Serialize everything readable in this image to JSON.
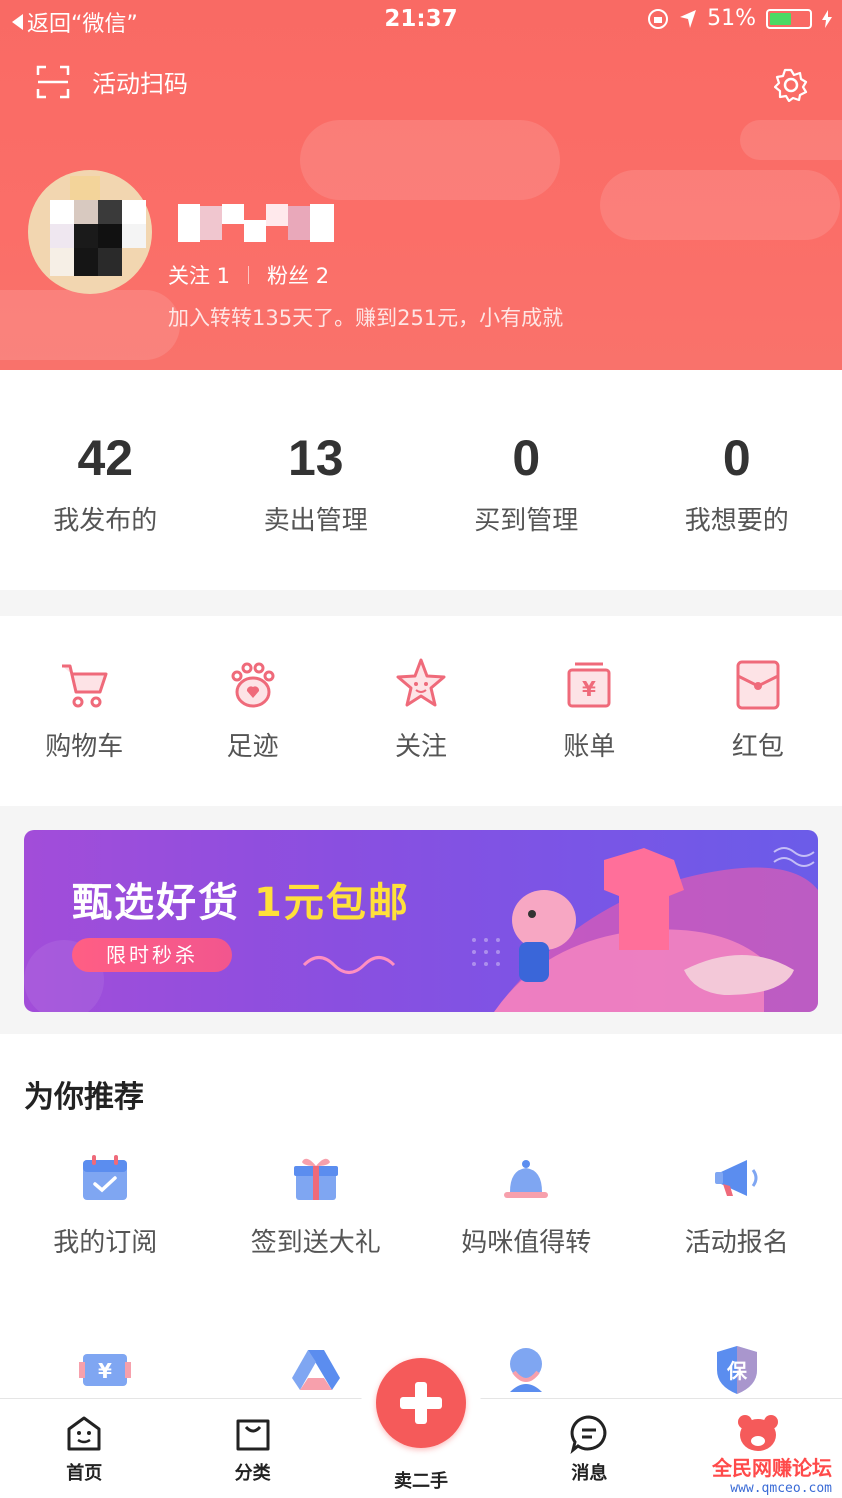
{
  "status_bar": {
    "back_label": "返回“微信”",
    "time": "21:37",
    "battery": "51%"
  },
  "header": {
    "scan_label": "活动扫码",
    "follow_label": "关注 1",
    "fans_label": "粉丝 2",
    "join_text": "加入转转135天了。赚到251元，小有成就"
  },
  "stats": [
    {
      "num": "42",
      "label": "我发布的"
    },
    {
      "num": "13",
      "label": "卖出管理"
    },
    {
      "num": "0",
      "label": "买到管理"
    },
    {
      "num": "0",
      "label": "我想要的"
    }
  ],
  "quick": [
    {
      "label": "购物车",
      "icon": "cart-icon"
    },
    {
      "label": "足迹",
      "icon": "paw-icon"
    },
    {
      "label": "关注",
      "icon": "star-icon"
    },
    {
      "label": "账单",
      "icon": "bill-icon"
    },
    {
      "label": "红包",
      "icon": "redpacket-icon"
    }
  ],
  "banner": {
    "title": "甄选好货",
    "highlight": "1元包邮",
    "button": "限时秒杀"
  },
  "recommend": {
    "title": "为你推荐",
    "items": [
      {
        "label": "我的订阅",
        "icon": "calendar-icon"
      },
      {
        "label": "签到送大礼",
        "icon": "gift-icon"
      },
      {
        "label": "妈咪值得转",
        "icon": "bell-icon"
      },
      {
        "label": "活动报名",
        "icon": "megaphone-icon"
      }
    ]
  },
  "tabbar": {
    "home": "首页",
    "category": "分类",
    "sell": "卖二手",
    "message": "消息"
  },
  "watermark": {
    "line1": "全民网赚论坛",
    "line2": "www.qmceo.com"
  },
  "colors": {
    "header_red": "#fb6e68",
    "accent": "#f55a5a",
    "icon_pink": "#ef6a7a",
    "icon_blue": "#5b8def"
  }
}
